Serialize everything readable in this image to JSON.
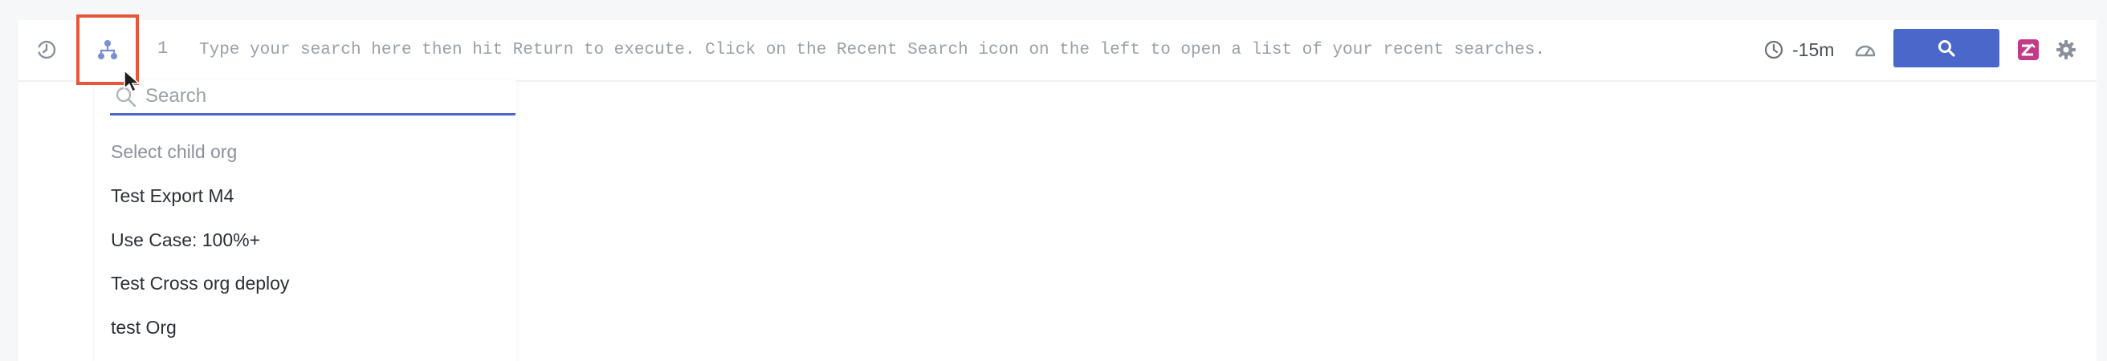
{
  "toolbar": {
    "line_number": "1",
    "query_placeholder": "Type your search here then hit Return to execute. Click on the Recent Search icon on the left to open a list of your recent searches.",
    "time_range": "-15m"
  },
  "icons": {
    "history": "history-icon",
    "org": "org-hierarchy-icon",
    "clock": "clock-icon",
    "speed": "speedometer-icon",
    "search": "search-icon",
    "app": "app-logo-icon",
    "settings": "gear-icon"
  },
  "colors": {
    "accent": "#4a68c9",
    "highlight_border": "#e8563a",
    "app_logo": "#c23b86"
  },
  "org_dropdown": {
    "search_placeholder": "Search",
    "header": "Select child org",
    "items": [
      "Test Export M4",
      "Use Case: 100%+",
      "Test Cross org deploy",
      "test Org"
    ]
  }
}
